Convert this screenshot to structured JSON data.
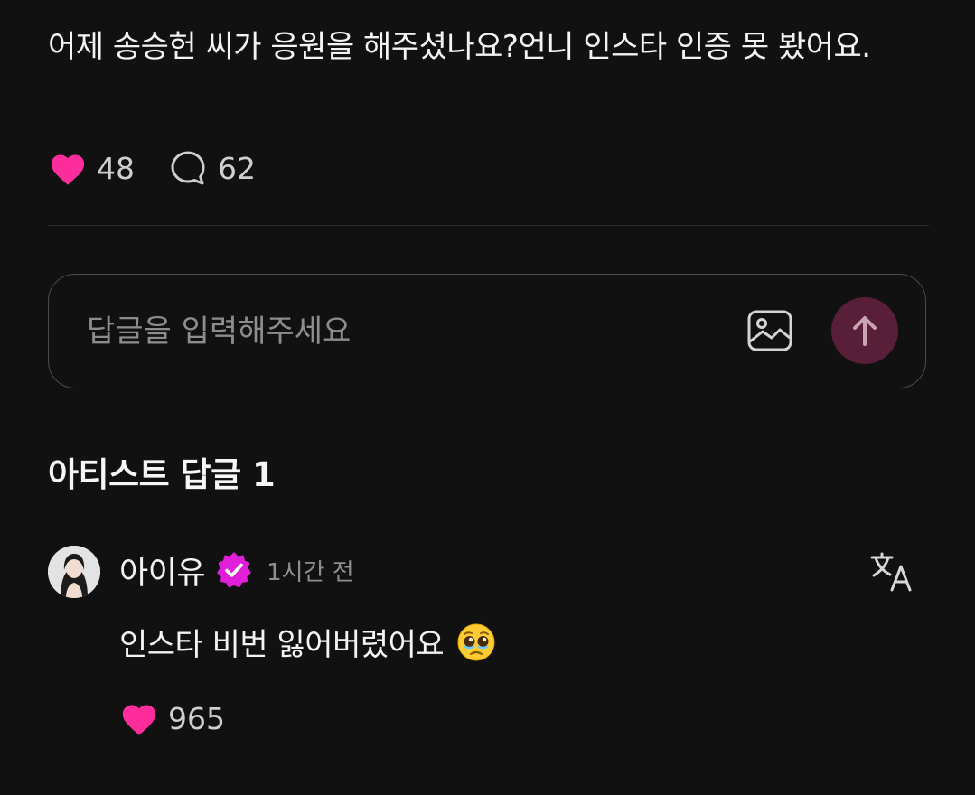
{
  "post": {
    "text": "어제 송승헌 씨가 응원을 해주셨나요?언니 인스타 인증 못 봤어요.",
    "like_count": "48",
    "comment_count": "62"
  },
  "reply_box": {
    "placeholder": "답글을 입력해주세요",
    "value": ""
  },
  "artist_replies": {
    "title": "아티스트 답글 1"
  },
  "comment": {
    "username": "아이유",
    "time": "1시간 전",
    "text": "인스타 비번 잃어버렸어요",
    "emoji": "pleading-face-emoji",
    "like_count": "965"
  },
  "colors": {
    "background": "#111111",
    "heart": "#ff2d9b",
    "badge": "#e020d8",
    "send_button": "#5a1f38"
  }
}
